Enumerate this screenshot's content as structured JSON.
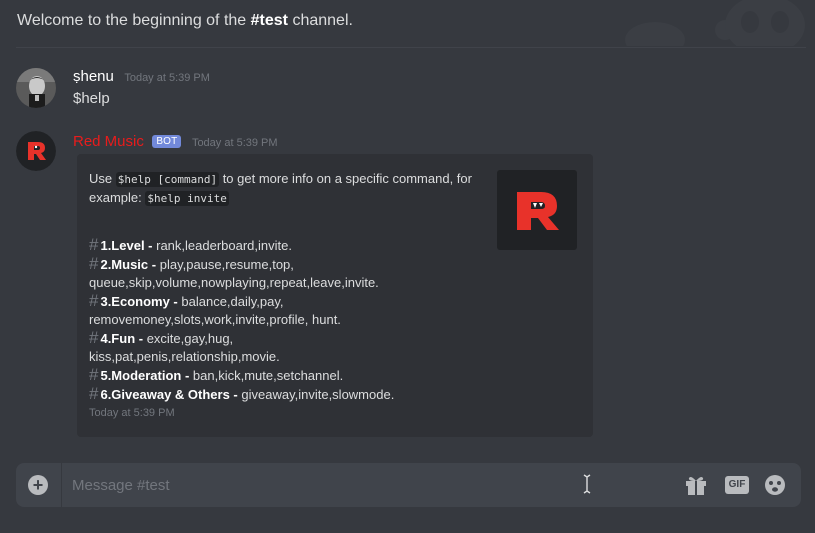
{
  "channel": {
    "welcome_prefix": "Welcome to the beginning of the ",
    "channel_name": "#test",
    "welcome_suffix": " channel."
  },
  "messages": [
    {
      "username": "ṣhenu",
      "timestamp": "Today at 5:39 PM",
      "content": "$help",
      "avatar": "user-avatar"
    },
    {
      "username": "Red Music",
      "badge": "BOT",
      "timestamp": "Today at 5:39 PM",
      "avatar": "red-music-r-logo",
      "embed": {
        "desc_pre": "Use ",
        "desc_code1": "$help [command]",
        "desc_mid": " to get more info on a specific command, for example: ",
        "desc_code2": "$help invite",
        "thumbnail": "red-music-r-logo",
        "commands": [
          {
            "category": "1.Level - ",
            "list": "rank,leaderboard,invite."
          },
          {
            "category": "2.Music - ",
            "list": "play,pause,resume,top,",
            "list2": "queue,skip,volume,nowplaying,repeat,leave,invite."
          },
          {
            "category": "3.Economy - ",
            "list": "balance,daily,pay,",
            "list2": "removemoney,slots,work,invite,profile, hunt."
          },
          {
            "category": "4.Fun - ",
            "list": "excite,gay,hug,",
            "list2": "kiss,pat,penis,relationship,movie."
          },
          {
            "category": "5.Moderation - ",
            "list": "ban,kick,mute,setchannel."
          },
          {
            "category": "6.Giveaway & Others - ",
            "list": "giveaway,invite,slowmode."
          }
        ],
        "footer": "Today at 5:39 PM"
      }
    }
  ],
  "input": {
    "placeholder": "Message #test",
    "add_icon": "plus-circle-icon",
    "gift_icon": "gift-icon",
    "gif_label": "GIF",
    "emoji_icon": "emoji-icon"
  },
  "colors": {
    "background": "#36393f",
    "bot_name": "#e81c1c",
    "bot_badge": "#7289da",
    "embed_bg": "#2f3136",
    "input_bg": "#40444b"
  }
}
